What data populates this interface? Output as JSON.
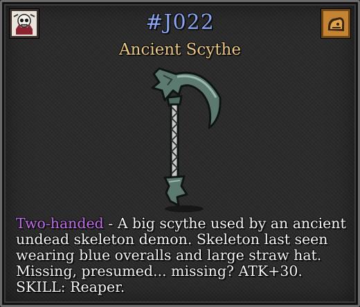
{
  "item": {
    "id": "#J022",
    "name": "Ancient Scythe",
    "handedness": "Two-handed",
    "separator": " - ",
    "description": "A big scythe used by an ancient undead skeleton demon. Skeleton last seen wearing blue overalls and large straw hat. Missing, presumed... missing? ATK+30. SKILL: Reaper."
  },
  "icons": {
    "left": "skull-portrait-icon",
    "right": "inventory-bag-icon",
    "center": "scythe-icon"
  },
  "colors": {
    "id": "#8aa4f0",
    "name": "#ecc885",
    "handedness": "#c06ee8",
    "text": "#f4f4f4"
  }
}
